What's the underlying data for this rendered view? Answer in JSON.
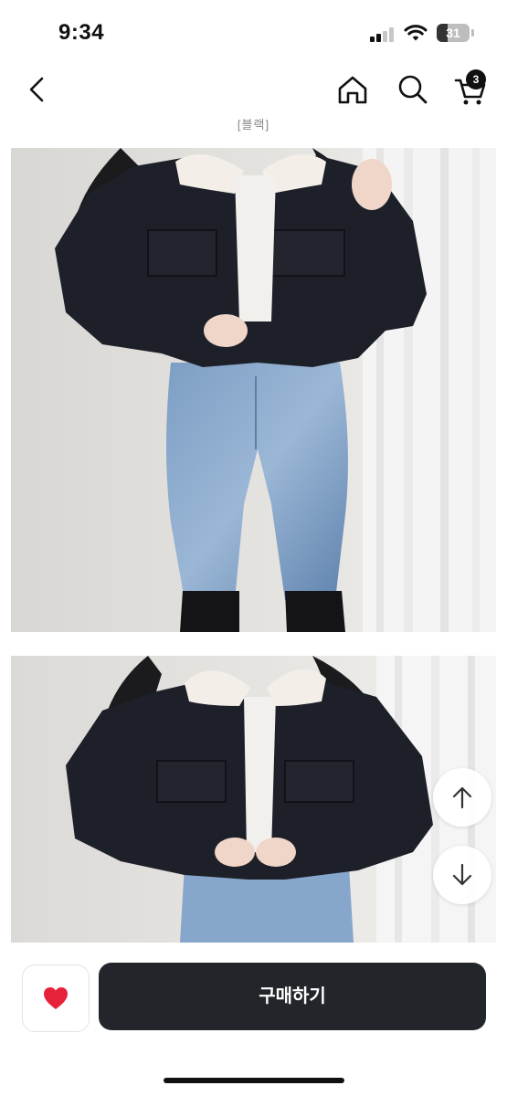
{
  "status_bar": {
    "time": "9:34",
    "battery_level": "31",
    "icons": [
      "signal-icon",
      "wifi-icon",
      "battery-icon"
    ]
  },
  "nav": {
    "icons": [
      "back-icon",
      "home-icon",
      "search-icon",
      "cart-icon"
    ],
    "cart_count": "3"
  },
  "product": {
    "color_caption": "[블랙]"
  },
  "floating": {
    "icons": [
      "arrow-up-icon",
      "arrow-down-icon"
    ]
  },
  "bottom_bar": {
    "buy_label": "구매하기",
    "like_icon": "heart-icon",
    "colors": {
      "heart": "#e8213a",
      "buy_bg": "#222529"
    }
  }
}
